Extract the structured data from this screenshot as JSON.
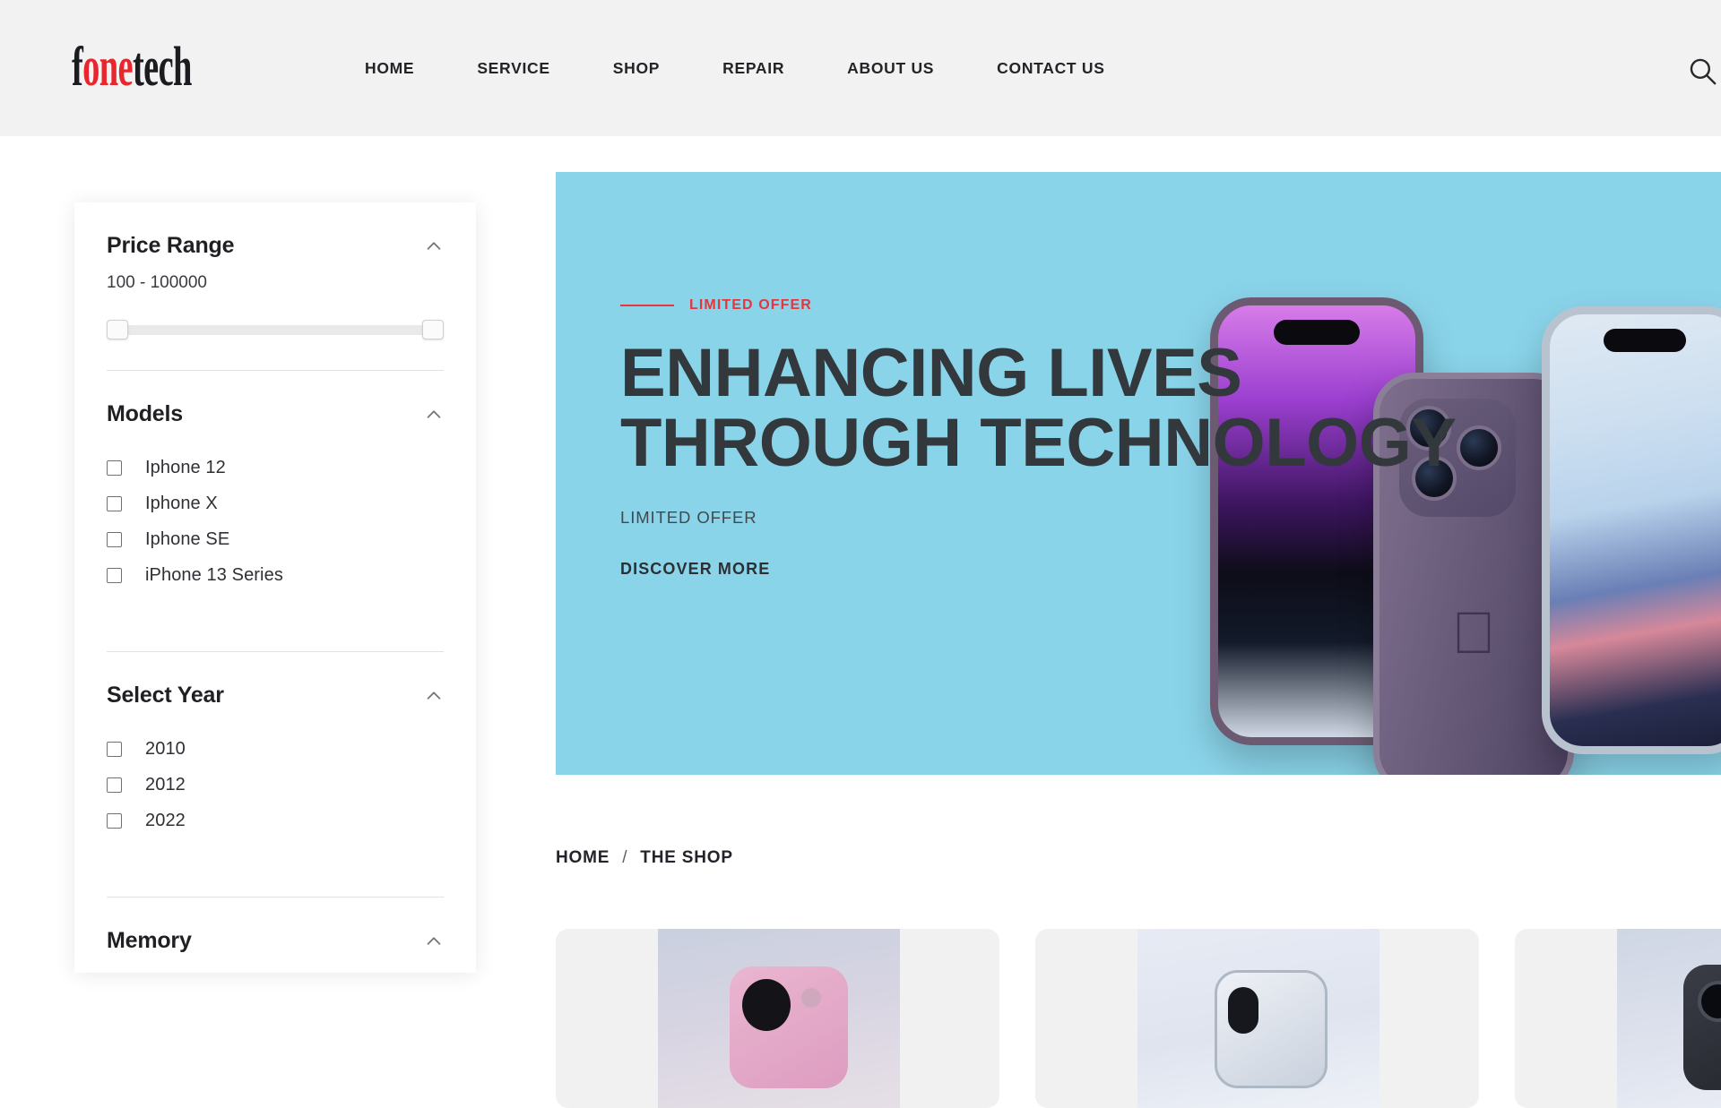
{
  "header": {
    "logo": {
      "part1": "f",
      "part2": "one",
      "part3": "tech"
    },
    "nav": [
      {
        "label": "HOME"
      },
      {
        "label": "SERVICE"
      },
      {
        "label": "SHOP"
      },
      {
        "label": "REPAIR"
      },
      {
        "label": "ABOUT US"
      },
      {
        "label": "CONTACT US"
      }
    ],
    "search_icon": "search-icon"
  },
  "sidebar": {
    "price": {
      "title": "Price Range",
      "value": "100 - 100000",
      "chevron": "chevron-up-icon"
    },
    "models": {
      "title": "Models",
      "chevron": "chevron-up-icon",
      "options": [
        {
          "label": "Iphone 12",
          "checked": false
        },
        {
          "label": "Iphone X",
          "checked": false
        },
        {
          "label": "Iphone SE",
          "checked": false
        },
        {
          "label": "iPhone 13 Series",
          "checked": false
        }
      ]
    },
    "year": {
      "title": "Select Year",
      "chevron": "chevron-up-icon",
      "options": [
        {
          "label": "2010",
          "checked": false
        },
        {
          "label": "2012",
          "checked": false
        },
        {
          "label": "2022",
          "checked": false
        }
      ]
    },
    "memory": {
      "title": "Memory",
      "chevron": "chevron-up-icon"
    }
  },
  "hero": {
    "background_color": "#8ad4ea",
    "eyebrow": "LIMITED OFFER",
    "eyebrow_color": "#e8343b",
    "title": "ENHANCING LIVES THROUGH TECHNOLOGY",
    "subtitle": "LIMITED OFFER",
    "cta": "DISCOVER MORE",
    "carousel": {
      "total": 2,
      "active_index": 1
    }
  },
  "breadcrumb": {
    "items": [
      {
        "label": "HOME"
      },
      {
        "label": "THE SHOP"
      }
    ],
    "separator": "/"
  },
  "products": [
    {
      "image": "phone-pink-camera"
    },
    {
      "image": "phone-silver-camera"
    },
    {
      "image": "phone-dark-camera"
    }
  ]
}
